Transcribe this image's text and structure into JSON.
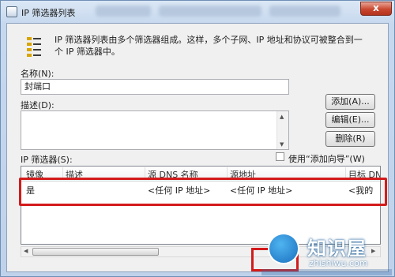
{
  "window": {
    "title": "IP 筛选器列表",
    "close_label": "x"
  },
  "intro_text": "IP 筛选器列表由多个筛选器组成。这样，多个子网、IP 地址和协议可被整合到一个 IP 筛选器中。",
  "name_field": {
    "label": "名称(N):",
    "value": "封端口"
  },
  "description_field": {
    "label": "描述(D):",
    "value": ""
  },
  "buttons": {
    "add": "添加(A)...",
    "edit": "编辑(E)...",
    "delete": "删除(R)"
  },
  "filters": {
    "label": "IP 筛选器(S):",
    "wizard_checkbox_label": "使用“添加向导”(W)",
    "wizard_checked": false,
    "columns": [
      "镜像",
      "描述",
      "源 DNS 名称",
      "源地址",
      "目标 DN"
    ],
    "rows": [
      [
        "是",
        "",
        "<任何 IP 地址>",
        "<任何 IP 地址>",
        "<我的"
      ]
    ]
  },
  "watermark": {
    "title": "知识屋",
    "subtitle": "zhishiwu.com"
  },
  "colors": {
    "highlight": "#d31b1b",
    "titlebar": "#c6d8ee",
    "close_button": "#c9472f"
  }
}
